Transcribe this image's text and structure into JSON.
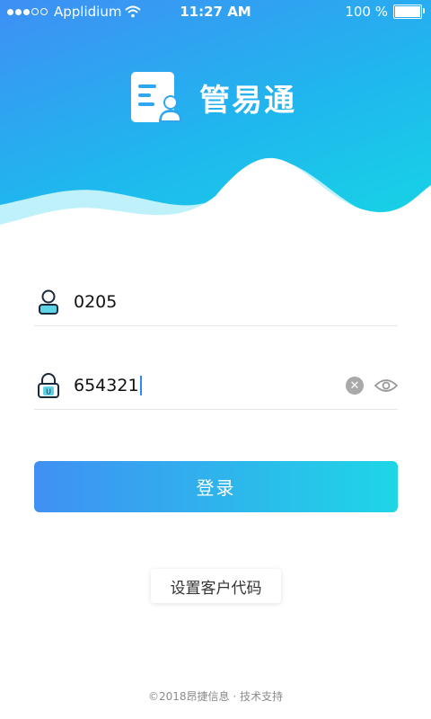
{
  "status_bar": {
    "carrier": "Applidium",
    "time": "11:27 AM",
    "battery": "100 %"
  },
  "app": {
    "name": "管易通"
  },
  "form": {
    "username_value": "0205",
    "password_value": "654321"
  },
  "buttons": {
    "login_label": "登录",
    "set_code_label": "设置客户代码"
  },
  "footer": {
    "text": "©2018昂捷信息 · 技术支持"
  },
  "colors": {
    "gradient_start": "#3f8ff4",
    "gradient_end": "#16d6e4",
    "caret": "#2d8cf0"
  },
  "icons": {
    "user": "user-icon",
    "lock": "lock-icon",
    "clear": "clear-icon",
    "eye": "eye-icon",
    "wifi": "wifi-icon",
    "battery": "battery-icon",
    "logo": "logo-icon"
  }
}
